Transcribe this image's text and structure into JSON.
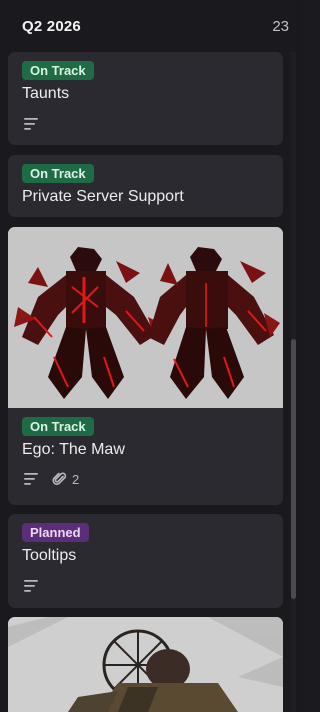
{
  "column": {
    "title": "Q2 2026",
    "count": "23"
  },
  "cards": [
    {
      "status": "On Track",
      "title": "Taunts",
      "has_description": true
    },
    {
      "status": "On Track",
      "title": "Private Server Support"
    },
    {
      "status": "On Track",
      "title": "Ego: The Maw",
      "has_description": true,
      "attachments": "2",
      "image": "red-armored-character-render"
    },
    {
      "status": "Planned",
      "title": "Tooltips",
      "has_description": true
    },
    {
      "image": "alter-ego-character-render"
    }
  ],
  "colors": {
    "on_track": "#1f6b45",
    "planned": "#5b2e78",
    "card_bg": "#2a2a30",
    "column_bg": "#1a1a1e"
  },
  "icons": {
    "description": "lines-description-icon",
    "attachment": "paperclip-icon"
  }
}
